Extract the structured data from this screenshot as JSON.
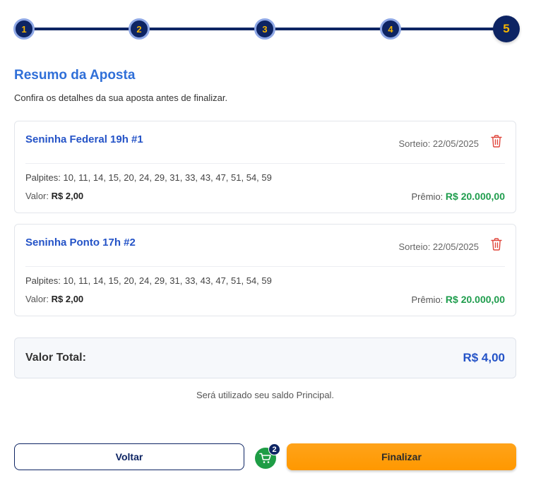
{
  "stepper": {
    "steps": [
      "1",
      "2",
      "3",
      "4",
      "5"
    ],
    "active": "5"
  },
  "header": {
    "title": "Resumo da Aposta",
    "subtitle": "Confira os detalhes da sua aposta antes de finalizar."
  },
  "bets": [
    {
      "name": "Seninha Federal 19h #1",
      "draw": "Sorteio: 22/05/2025",
      "picks": "Palpites: 10, 11, 14, 15, 20, 24, 29, 31, 33, 43, 47, 51, 54, 59",
      "value_label": "Valor:",
      "value": "R$ 2,00",
      "prize_label": "Prêmio:",
      "prize": "R$ 20.000,00"
    },
    {
      "name": "Seninha Ponto 17h #2",
      "draw": "Sorteio: 22/05/2025",
      "picks": "Palpites: 10, 11, 14, 15, 20, 24, 29, 31, 33, 43, 47, 51, 54, 59",
      "value_label": "Valor:",
      "value": "R$ 2,00",
      "prize_label": "Prêmio:",
      "prize": "R$ 20.000,00"
    }
  ],
  "total": {
    "label": "Valor Total:",
    "amount": "R$ 4,00"
  },
  "note": "Será utilizado seu saldo Principal.",
  "actions": {
    "back_label": "Voltar",
    "finish_label": "Finalizar",
    "cart_count": "2",
    "cart_icon": "cart-icon"
  },
  "colors": {
    "primary_navy": "#0d2463",
    "accent_blue": "#2453c7",
    "step_number": "#f4b400",
    "prize_green": "#1f9d4d",
    "finish_orange": "#ff9800",
    "trash_red": "#e0463c"
  }
}
